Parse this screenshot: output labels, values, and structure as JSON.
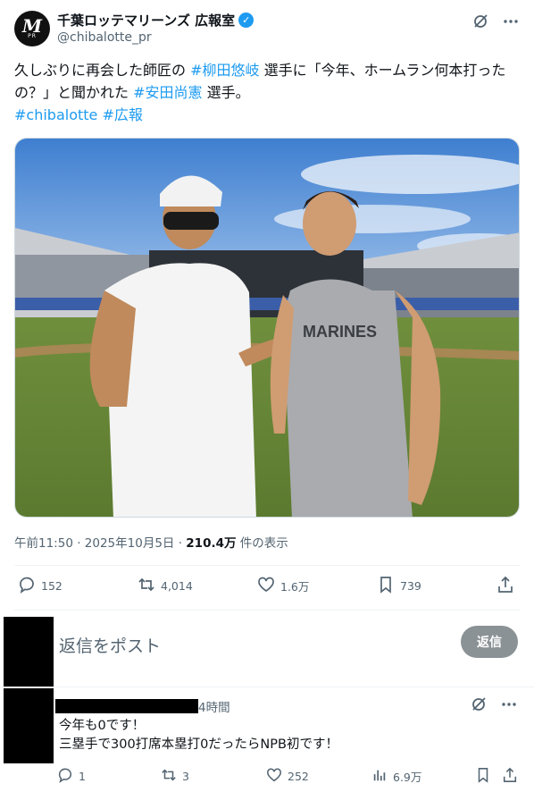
{
  "post": {
    "avatar_text": "M",
    "avatar_sub": "PR",
    "display_name": "千葉ロッテマリーンズ 広報室",
    "handle": "@chibalotte_pr",
    "text_parts": {
      "p1": "久しぶりに再会した師匠の ",
      "link1": "#柳田悠岐",
      "p2": " 選手に「今年、ホームラン何本打ったの？」と聞かれた ",
      "link2": "#安田尚憲",
      "p3": " 選手。",
      "link3": "#chibalotte",
      "link4": "#広報"
    },
    "meta_time": "午前11:50 · 2025年10月5日 · ",
    "meta_views": "210.4万",
    "meta_views_label": " 件の表示",
    "stats": {
      "replies": "152",
      "reposts": "4,014",
      "likes": "1.6万",
      "bookmarks": "739"
    },
    "jersey_text": "MARINES"
  },
  "reply": {
    "placeholder": "返信をポスト",
    "button": "返信"
  },
  "comment": {
    "time": "4時間",
    "line1": "今年も0です！",
    "line2": "三塁手で300打席本塁打0だったらNPB初です！",
    "stats": {
      "replies": "1",
      "reposts": "3",
      "likes": "252",
      "views": "6.9万"
    }
  },
  "colors": {
    "link": "#1d9bf0",
    "text": "#0f1419",
    "muted": "#536471"
  }
}
